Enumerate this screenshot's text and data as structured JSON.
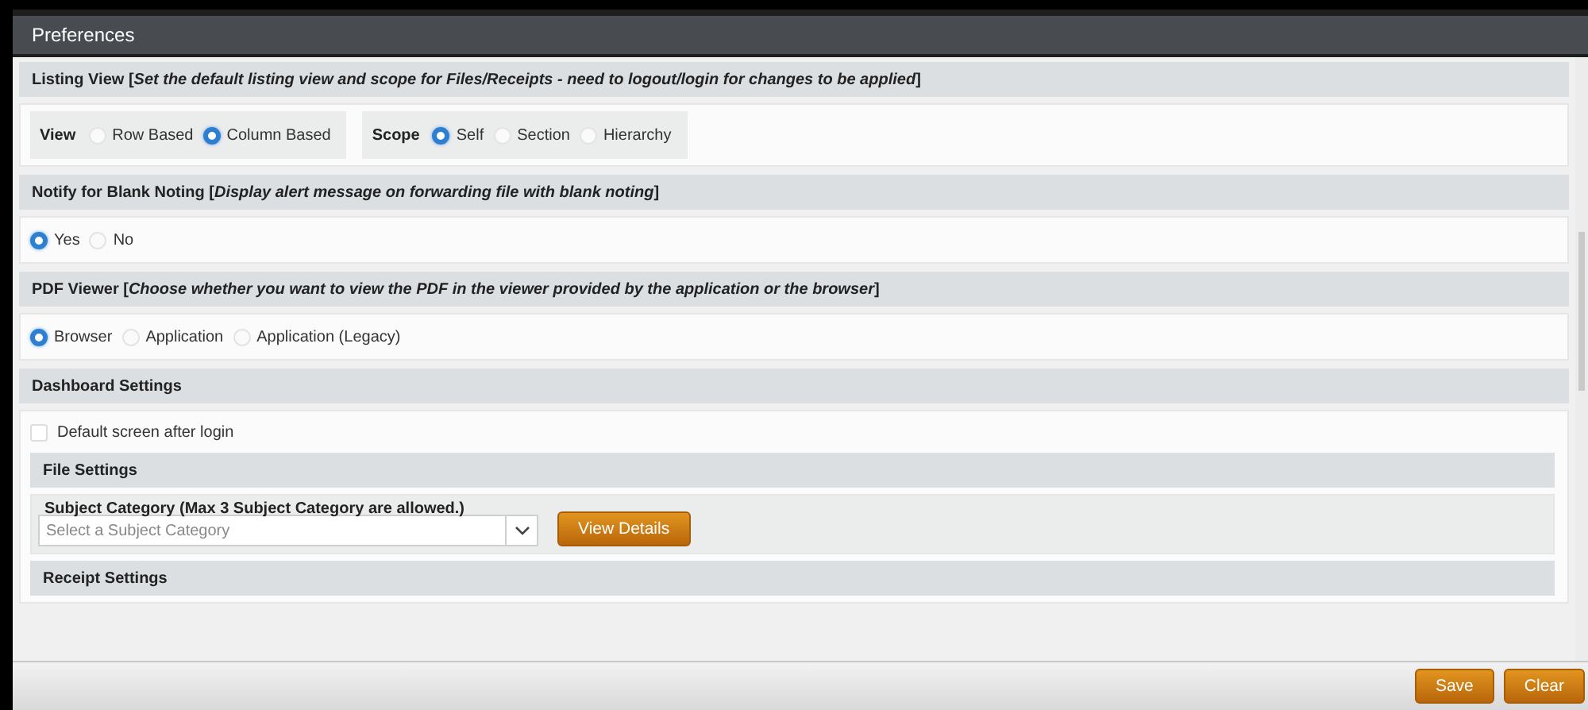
{
  "window": {
    "title": "Preferences"
  },
  "sections": [
    {
      "kind": "radios",
      "title": "Listing View  [*Set the default listing view and scope for Files/Receipts - need to logout/login for changes to be applied*]",
      "groups": [
        {
          "label": "View",
          "options": [
            {
              "label": "Row Based",
              "selected": false
            },
            {
              "label": "Column Based",
              "selected": true
            }
          ]
        },
        {
          "label": "Scope",
          "options": [
            {
              "label": "Self",
              "selected": true
            },
            {
              "label": "Section",
              "selected": false
            },
            {
              "label": "Hierarchy",
              "selected": false
            }
          ]
        }
      ]
    },
    {
      "kind": "radios",
      "title": "Notify for Blank Noting  [*Display alert message on forwarding file with blank noting*]",
      "groups": [
        {
          "options": [
            {
              "label": "Yes",
              "selected": true
            },
            {
              "label": "No",
              "selected": false
            }
          ]
        }
      ]
    },
    {
      "kind": "radios",
      "title": "PDF Viewer  [*Choose whether you want to view the PDF in the viewer provided by the application or the browser*]",
      "groups": [
        {
          "options": [
            {
              "label": "Browser",
              "selected": true
            },
            {
              "label": "Application",
              "selected": false
            },
            {
              "label": "Application (Legacy)",
              "selected": false
            }
          ]
        }
      ]
    },
    {
      "kind": "dashboard",
      "title": "Dashboard Settings",
      "checkbox": {
        "label": "Default screen after login",
        "checked": false
      },
      "subsections": [
        {
          "title": "File Settings",
          "field": {
            "label": "Subject Category (Max 3 Subject Category are allowed.)",
            "placeholder": "Select a Subject Category"
          },
          "button": "View Details"
        },
        {
          "title": "Receipt Settings"
        }
      ]
    }
  ],
  "footer_buttons": [
    "Save",
    "Clear"
  ]
}
